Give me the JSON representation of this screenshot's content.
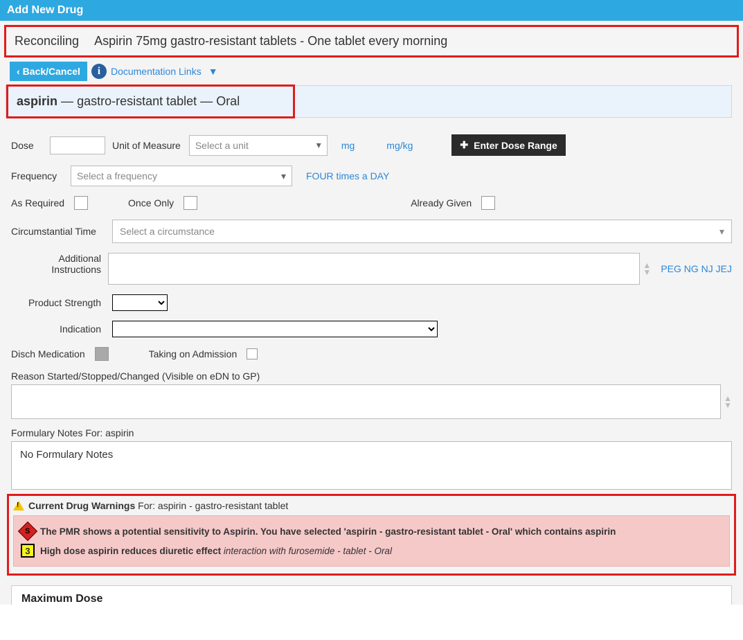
{
  "title": "Add New Drug",
  "reconciling": {
    "label": "Reconciling",
    "text": "Aspirin 75mg gastro-resistant tablets - One tablet every morning"
  },
  "toolbar": {
    "back_label": "Back/Cancel",
    "doc_links_label": "Documentation Links"
  },
  "drug_bar": {
    "name": "aspirin",
    "form": "gastro-resistant tablet",
    "route": "Oral"
  },
  "dose": {
    "label": "Dose",
    "value": "",
    "uom_label": "Unit of Measure",
    "uom_placeholder": "Select a unit",
    "quick_mg": "mg",
    "quick_mgkg": "mg/kg",
    "range_btn": "Enter Dose Range"
  },
  "frequency": {
    "label": "Frequency",
    "placeholder": "Select a frequency",
    "quick": "FOUR times a DAY"
  },
  "checks": {
    "as_required": "As Required",
    "once_only": "Once Only",
    "already_given": "Already Given"
  },
  "circumstance": {
    "label": "Circumstantial Time",
    "placeholder": "Select a circumstance"
  },
  "additional": {
    "label_line1": "Additional",
    "label_line2": "Instructions",
    "quick": "PEG NG NJ JEJ"
  },
  "strength_label": "Product Strength",
  "indication_label": "Indication",
  "disch_label": "Disch Medication",
  "taking_label": "Taking on Admission",
  "reason_label": "Reason Started/Stopped/Changed (Visible on eDN to GP)",
  "formulary": {
    "label": "Formulary Notes For: aspirin",
    "text": "No Formulary Notes"
  },
  "warnings": {
    "header_bold": "Current Drug Warnings",
    "header_rest": "For: aspirin - gastro-resistant tablet",
    "sensitivity": "The PMR shows a potential sensitivity to Aspirin. You have selected 'aspirin - gastro-resistant tablet - Oral' which contains aspirin",
    "interaction_badge": "3",
    "interaction_bold": "High dose aspirin reduces diuretic effect",
    "interaction_ital": "interaction with furosemide - tablet - Oral"
  },
  "max_dose_label": "Maximum Dose"
}
